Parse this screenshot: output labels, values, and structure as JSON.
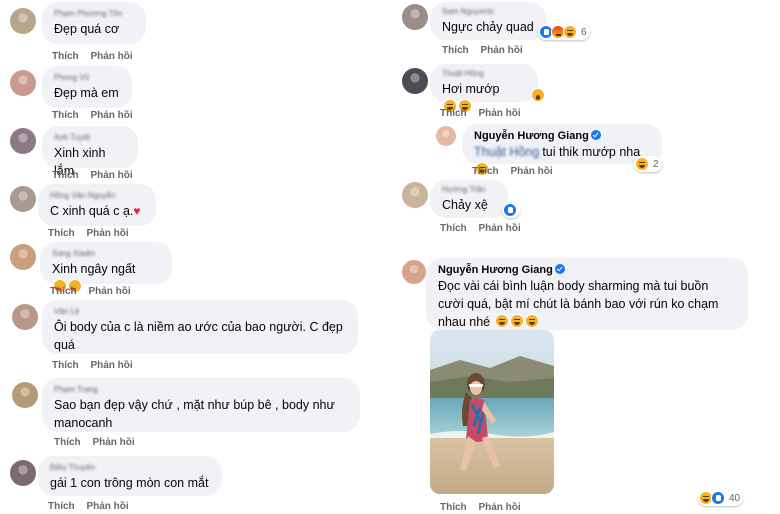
{
  "actions": {
    "like": "Thích",
    "reply": "Phản hồi"
  },
  "colors": {
    "bubble": "#f0f2f5",
    "meta": "#65676b",
    "like_blue": "#1877f2",
    "haha_yellow": "#f7b125"
  },
  "left_comments": [
    {
      "author": "Phạm Phương Tôn",
      "text": "Đẹp quá cơ"
    },
    {
      "author": "Phong Vũ",
      "text": "Đẹp mà em"
    },
    {
      "author": "Anh Tuyết",
      "text": "Xinh xinh lắm"
    },
    {
      "author": "Hồng Vân Nguyễn",
      "text": "C xinh quá c ạ.",
      "trailing_icon": "heart-icon"
    },
    {
      "author": "Xang Xiadin",
      "text": "Xinh ngây ngất",
      "trailing_icon": "heart-eyes-icon"
    },
    {
      "author": "Vân Lê",
      "text": "Ôi body của c là niềm ao ước của bao người. C đẹp quá"
    },
    {
      "author": "Phạm Trang",
      "text": "Sao bạn đẹp vậy chứ , mặt như búp bê , body như manocanh"
    },
    {
      "author": "Điều Thuyên",
      "text": "gái 1 con trông mòn con mắt"
    }
  ],
  "right_comments": [
    {
      "author": "Sam Nguyentc",
      "text": "Ngực chảy quad",
      "reaction_count": "6",
      "reaction_icons": [
        "like-icon",
        "angry-icon",
        "haha-icon"
      ]
    },
    {
      "author": "Thuật Hồng",
      "text": "Hơi mướp",
      "reaction_icons": [
        "haha-icon",
        "wow-icon"
      ]
    },
    {
      "author": "Nguyễn Hương Giang",
      "reply_tag": "Thuật Hồng",
      "text": "tui thik mướp nha",
      "reaction_count": "2"
    },
    {
      "author": "Hường Trần",
      "text": "Chảy xệ",
      "reaction_icons": [
        "like-icon"
      ]
    },
    {
      "author": "Nguyễn Hương Giang",
      "text": "Đọc vài cái bình luận body sharming mà tui buồn cười quá, bật mí chút là bánh bao với rún ko chạm nhau nhé",
      "reaction_count": "40"
    }
  ]
}
